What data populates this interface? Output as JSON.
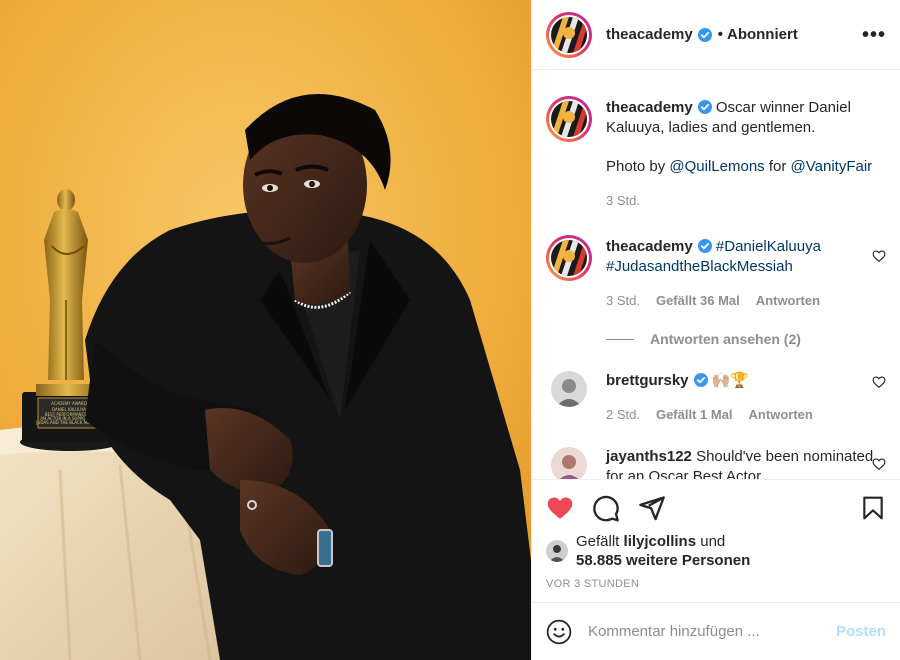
{
  "post": {
    "image_alt": "Daniel Kaluuya in black suit posing with Oscar statuette against yellow background",
    "oscar_plaque_lines": [
      "ACADEMY AWARD",
      "DANIEL KALUUYA",
      "BEST PERFORMANCE BY",
      "AN ACTOR IN A SUPPORTING",
      "ROLE",
      "JUDAS AND THE BLACK MESSIAH"
    ]
  },
  "header": {
    "username": "theacademy",
    "verified": true,
    "separator": "•",
    "follow_state": "Abonniert",
    "more_icon": "ellipsis-icon"
  },
  "caption": {
    "username": "theacademy",
    "line1": "Oscar winner Daniel Kaluuya, ladies and gentlemen.",
    "photo_by_prefix": "Photo by",
    "photographer": "@QuilLemons",
    "for": "for",
    "outlet": "@VanityFair",
    "time": "3 Std."
  },
  "comments": [
    {
      "username": "theacademy",
      "verified": true,
      "tags": [
        "#DanielKaluuya",
        "#JudasandtheBlackMessiah"
      ],
      "time": "3 Std.",
      "likes": "Gefällt 36 Mal",
      "reply": "Antworten",
      "view_replies": "Antworten ansehen (2)"
    },
    {
      "username": "brettgursky",
      "verified": true,
      "text": "🙌🏼🏆",
      "time": "2 Std.",
      "likes": "Gefällt 1 Mal",
      "reply": "Antworten"
    },
    {
      "username": "jayanths122",
      "text": "Should've been nominated for an Oscar Best Actor"
    }
  ],
  "actions": {
    "liked": true,
    "like_color": "#ed4956",
    "liked_by_prefix": "Gefällt",
    "liked_by_user": "lilyjcollins",
    "liked_by_and": "und",
    "others_count": "58.885 weitere Personen",
    "timestamp": "VOR 3 STUNDEN"
  },
  "composer": {
    "placeholder": "Kommentar hinzufügen ...",
    "post_label": "Posten",
    "emoji_icon": "smiley-icon"
  },
  "colors": {
    "link": "#00376b",
    "muted": "#8e8e8e",
    "post_disabled": "#b2dffc",
    "verified": "#3897f0",
    "background_yellow": "#f2b341"
  }
}
